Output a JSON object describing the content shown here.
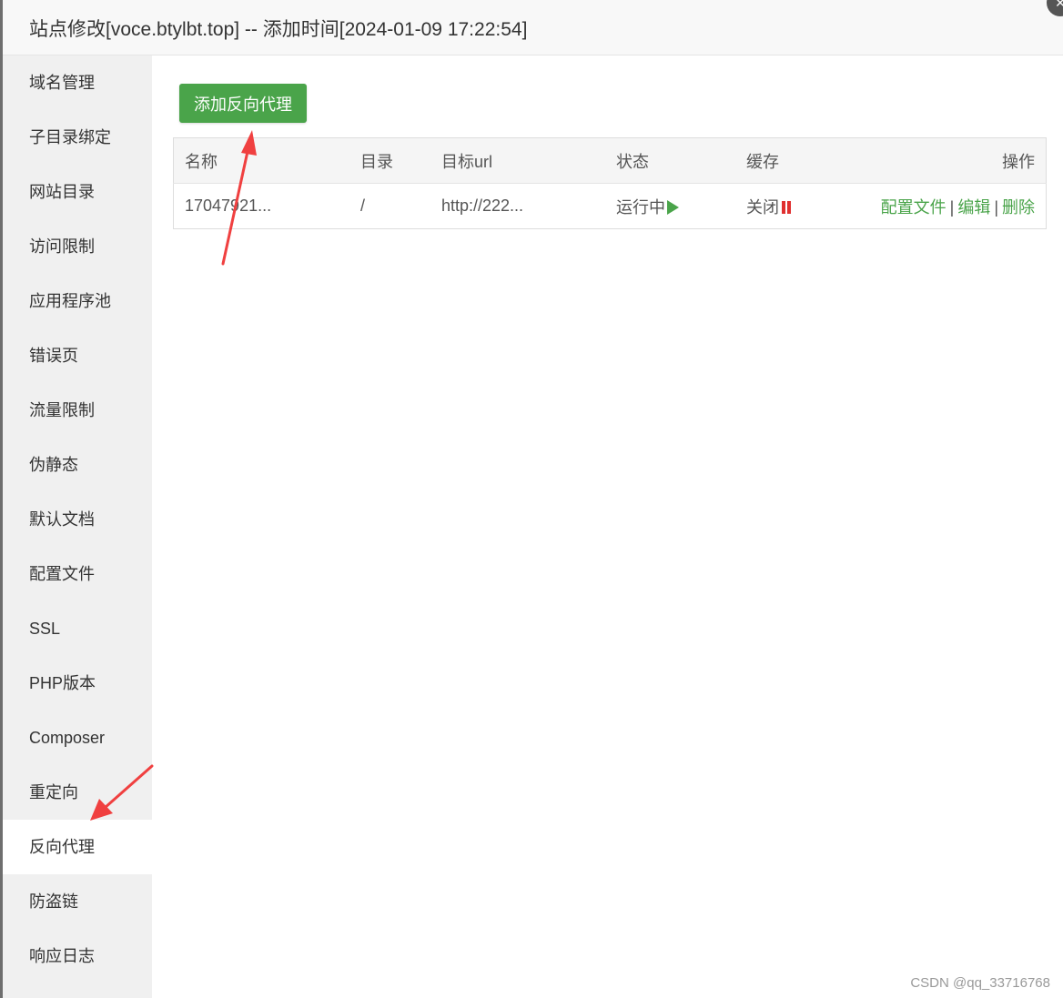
{
  "window": {
    "title": "站点修改[voce.btylbt.top] -- 添加时间[2024-01-09 17:22:54]",
    "close_icon": "✕"
  },
  "sidebar": {
    "items": [
      {
        "label": "域名管理"
      },
      {
        "label": "子目录绑定"
      },
      {
        "label": "网站目录"
      },
      {
        "label": "访问限制"
      },
      {
        "label": "应用程序池"
      },
      {
        "label": "错误页"
      },
      {
        "label": "流量限制"
      },
      {
        "label": "伪静态"
      },
      {
        "label": "默认文档"
      },
      {
        "label": "配置文件"
      },
      {
        "label": "SSL"
      },
      {
        "label": "PHP版本"
      },
      {
        "label": "Composer"
      },
      {
        "label": "重定向"
      },
      {
        "label": "反向代理",
        "active": true
      },
      {
        "label": "防盗链"
      },
      {
        "label": "响应日志"
      }
    ]
  },
  "main": {
    "add_button_label": "添加反向代理",
    "table": {
      "headers": {
        "name": "名称",
        "dir": "目录",
        "target": "目标url",
        "status": "状态",
        "cache": "缓存",
        "ops": "操作"
      },
      "rows": [
        {
          "name": "17047921...",
          "dir": "/",
          "target": "http://222...",
          "status": "运行中",
          "cache": "关闭",
          "ops": {
            "config": "配置文件",
            "sep1": "|",
            "edit": "编辑",
            "sep2": "|",
            "delete": "删除"
          }
        }
      ]
    }
  },
  "watermark": "CSDN @qq_33716768",
  "colors": {
    "accent_green": "#4aa44a",
    "danger_red": "#e03030",
    "annotation_arrow": "#f04040"
  }
}
